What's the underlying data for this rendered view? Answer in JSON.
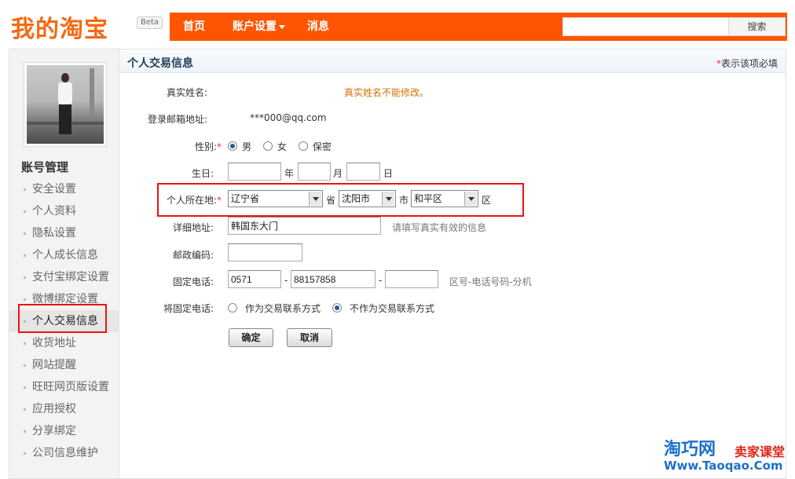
{
  "header": {
    "logo": "我的淘宝",
    "beta": "Beta",
    "nav": {
      "home": "首页",
      "account": "账户设置",
      "messages": "消息"
    },
    "search": {
      "value": "",
      "button": "搜索"
    }
  },
  "sidebar": {
    "title": "账号管理",
    "items": [
      {
        "label": "安全设置"
      },
      {
        "label": "个人资料"
      },
      {
        "label": "隐私设置"
      },
      {
        "label": "个人成长信息"
      },
      {
        "label": "支付宝绑定设置"
      },
      {
        "label": "微博绑定设置"
      },
      {
        "label": "个人交易信息",
        "active": true
      },
      {
        "label": "收货地址"
      },
      {
        "label": "网站提醒"
      },
      {
        "label": "旺旺网页版设置"
      },
      {
        "label": "应用授权"
      },
      {
        "label": "分享绑定"
      },
      {
        "label": "公司信息维护"
      }
    ]
  },
  "main": {
    "title": "个人交易信息",
    "required_star": "*",
    "required_note": "表示该项必填",
    "form": {
      "real_name": {
        "label": "真实姓名:",
        "note": "真实姓名不能修改。"
      },
      "email": {
        "label": "登录邮箱地址:",
        "value": "***000@qq.com"
      },
      "gender": {
        "label": "性别:",
        "star": "*",
        "options": [
          "男",
          "女",
          "保密"
        ],
        "selected": "男"
      },
      "birthday": {
        "label": "生日:",
        "year_unit": "年",
        "month_unit": "月",
        "day_unit": "日",
        "year": "",
        "month": "",
        "day": ""
      },
      "region": {
        "label": "个人所在地:",
        "star": "*",
        "province": "辽宁省",
        "province_unit": "省",
        "city": "沈阳市",
        "city_unit": "市",
        "district": "和平区",
        "district_unit": "区"
      },
      "address": {
        "label": "详细地址:",
        "value": "韩国东大门",
        "hint": "请填写真实有效的信息"
      },
      "postcode": {
        "label": "邮政编码:",
        "value": ""
      },
      "phone": {
        "label": "固定电话:",
        "area": "0571",
        "sep1": "-",
        "number": "88157858",
        "sep2": "-",
        "ext": "",
        "hint": "区号-电话号码-分机"
      },
      "phone_contact": {
        "label": "将固定电话:",
        "options": [
          "作为交易联系方式",
          "不作为交易联系方式"
        ],
        "selected": "不作为交易联系方式"
      },
      "buttons": {
        "confirm": "确定",
        "cancel": "取消"
      }
    }
  },
  "watermark": {
    "brand": "淘巧网",
    "sub": "卖家课堂",
    "url": "Www.Taoqao.Com"
  }
}
